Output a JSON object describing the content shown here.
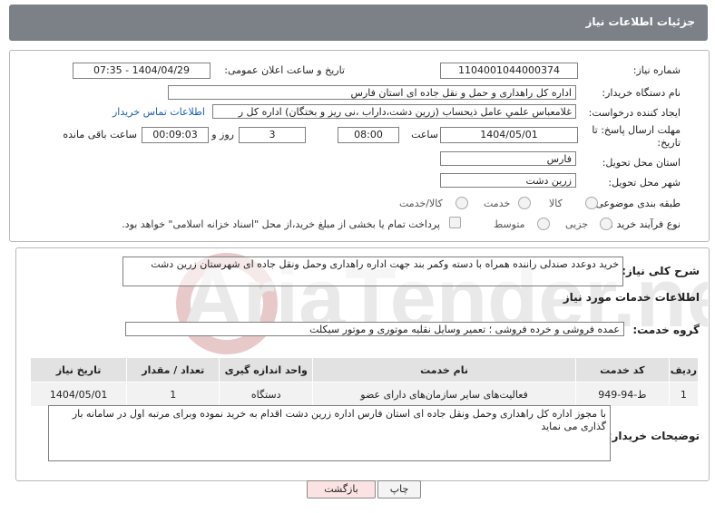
{
  "header": {
    "title": "جزئیات اطلاعات نیاز"
  },
  "form": {
    "need_number_label": "شماره نیاز:",
    "need_number": "1104001044000374",
    "announce_label": "تاریخ و ساعت اعلان عمومی:",
    "announce_value": "1404/04/29 - 07:35",
    "buyer_org_label": "نام دستگاه خریدار:",
    "buyer_org": "اداره کل راهداری و حمل و نقل جاده ای استان فارس",
    "requester_label": "ایجاد کننده درخواست:",
    "requester": "غلامعباس علمي عامل ذيحساب (زرين دشت،داراب ،نی ريز و بختگان) اداره کل ر",
    "contact_link": "اطلاعات تماس خریدار",
    "deadline_label": "مهلت ارسال پاسخ: تا تاریخ:",
    "deadline_date": "1404/05/01",
    "time_label": "ساعت",
    "deadline_time": "08:00",
    "days_value": "3",
    "days_label": "روز و",
    "remaining_time": "00:09:03",
    "remaining_label": "ساعت باقی مانده",
    "province_label": "استان محل تحویل:",
    "province": "فارس",
    "city_label": "شهر محل تحویل:",
    "city": "زرین دشت",
    "category_label": "طبقه بندی موضوعی:",
    "category_options": [
      "کالا",
      "خدمت",
      "کالا/خدمت"
    ],
    "process_label": "نوع فرآیند خرید :",
    "process_options": [
      "جزیی",
      "متوسط"
    ],
    "payment_note": "پرداخت تمام یا بخشی از مبلغ خرید،از محل \"اسناد خزانه اسلامی\" خواهد بود."
  },
  "details": {
    "summary_label": "شرح کلی نیاز:",
    "summary": "خرید دوعدد صندلی راننده همراه با دسته وکمر بند جهت اداره راهداری وحمل ونقل جاده ای شهرستان زرین دشت",
    "services_title": "اطلاعات خدمات مورد نیاز",
    "service_group_label": "گروه خدمت:",
    "service_group": "عمده فروشی و خرده فروشی ؛ تعمیر وسایل نقلیه موتوری و موتور سیکلت",
    "table": {
      "headers": [
        "ردیف",
        "کد خدمت",
        "نام خدمت",
        "واحد اندازه گیری",
        "تعداد / مقدار",
        "تاریخ نیاز"
      ],
      "rows": [
        [
          "1",
          "ط-94-949",
          "فعالیت‌های سایر سازمان‌های دارای عضو",
          "دستگاه",
          "1",
          "1404/05/01"
        ]
      ]
    },
    "buyer_notes_label": "توضیحات خریدار:",
    "buyer_notes": "با مجوز اداره کل راهداری وحمل ونقل جاده ای استان فارس اداره زرین دشت اقدام به خرید نموده وبرای مرتبه اول در سامانه بار گذاری می نماید"
  },
  "buttons": {
    "print": "چاپ",
    "back": "بازگشت"
  },
  "watermark": {
    "text": "AriaTender.net"
  }
}
